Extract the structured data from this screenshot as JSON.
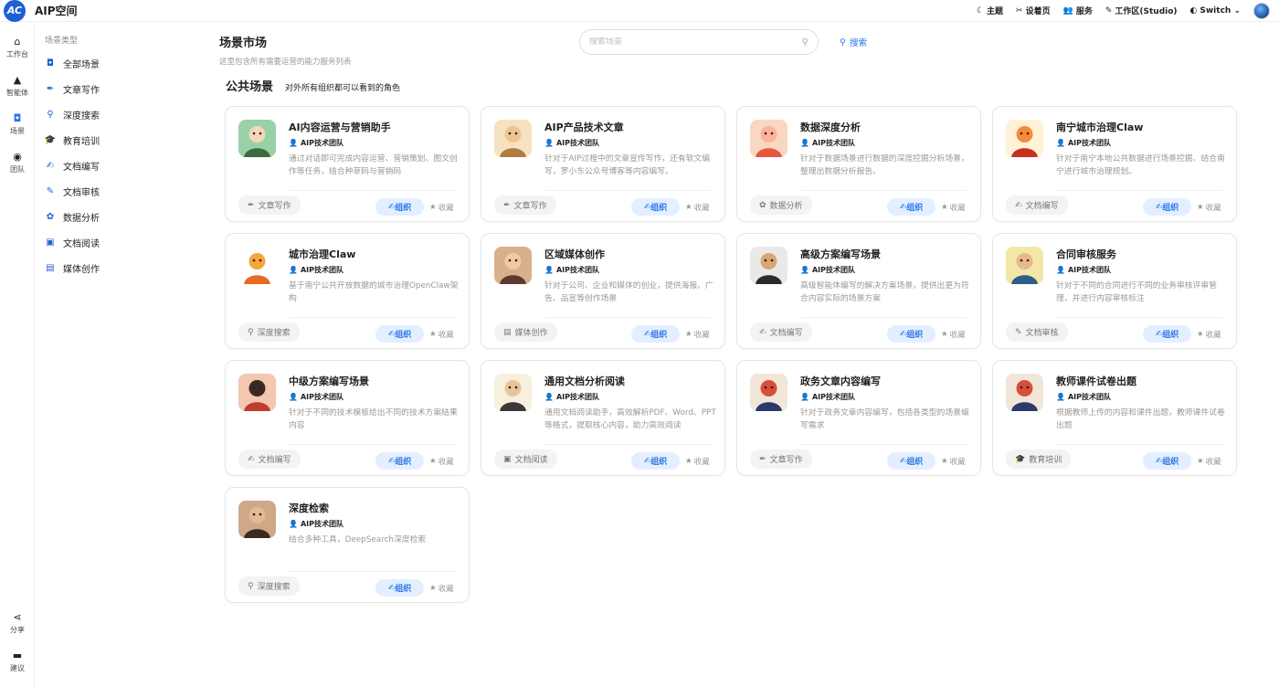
{
  "app": {
    "logo_text": "AC",
    "title": "AIP空间"
  },
  "topnav": [
    {
      "icon": "moon-icon",
      "glyph": "☾",
      "label": "主题"
    },
    {
      "icon": "tools-icon",
      "glyph": "✂",
      "label": "设着页"
    },
    {
      "icon": "users-icon",
      "glyph": "👥",
      "label": "服务"
    },
    {
      "icon": "pen-icon",
      "glyph": "✎",
      "label": "工作区(Studio)"
    },
    {
      "icon": "shield-icon",
      "glyph": "◐",
      "label": "Switch ⌄"
    }
  ],
  "rail": [
    {
      "icon": "home-icon",
      "glyph": "⌂",
      "label": "工作台"
    },
    {
      "icon": "agent-icon",
      "glyph": "▲",
      "label": "智能体"
    },
    {
      "icon": "scene-icon",
      "glyph": "◘",
      "label": "场景"
    },
    {
      "icon": "team-icon",
      "glyph": "◉",
      "label": "团队"
    },
    {
      "icon": "share-icon",
      "glyph": "⋖",
      "label": "分享"
    },
    {
      "icon": "chat-icon",
      "glyph": "▬",
      "label": "建议"
    }
  ],
  "sidebar": {
    "title": "场景类型",
    "items": [
      {
        "icon": "all-scenes-icon",
        "glyph": "◘",
        "label": "全部场景"
      },
      {
        "icon": "pen-icon",
        "glyph": "✒",
        "label": "文章写作"
      },
      {
        "icon": "search-icon",
        "glyph": "⚲",
        "label": "深度搜索"
      },
      {
        "icon": "graduation-cap-icon",
        "glyph": "🎓",
        "label": "教育培训"
      },
      {
        "icon": "doc-edit-icon",
        "glyph": "✍",
        "label": "文档编写"
      },
      {
        "icon": "doc-review-icon",
        "glyph": "✎",
        "label": "文档审核"
      },
      {
        "icon": "data-analysis-icon",
        "glyph": "✿",
        "label": "数据分析"
      },
      {
        "icon": "doc-read-icon",
        "glyph": "▣",
        "label": "文档阅读"
      },
      {
        "icon": "media-icon",
        "glyph": "▤",
        "label": "媒体创作"
      }
    ]
  },
  "header": {
    "title": "场景市场",
    "subtitle": "这里包含所有需要运营的能力服务列表",
    "search_placeholder": "搜索场景",
    "search_button": "搜索"
  },
  "section": {
    "title": "公共场景",
    "subtitle": "对外所有组织都可以看到的角色"
  },
  "card_common": {
    "team": "AIP技术团队",
    "org": "组织",
    "fav": "收藏"
  },
  "cards": [
    {
      "title": "AI内容运营与营销助手",
      "desc": "通过对话即可完成内容运营、营销策划、图文创作等任务，结合种草码与营销码",
      "tag": "文章写作",
      "tag_icon": "✒",
      "avatar": "a1"
    },
    {
      "title": "AIP产品技术文章",
      "desc": "针对于AIP过程中的文章宣传写作，还有软文编写，罗小东公众号博客等内容编写。",
      "tag": "文章写作",
      "tag_icon": "✒",
      "avatar": "a2"
    },
    {
      "title": "数据深度分析",
      "desc": "针对于数据场景进行数据的深度挖掘分析场景，整理出数据分析报告。",
      "tag": "数据分析",
      "tag_icon": "✿",
      "avatar": "a3"
    },
    {
      "title": "南宁城市治理Claw",
      "desc": "针对于南宁本地公共数据进行场景挖掘、结合南宁进行城市治理规划。",
      "tag": "文档编写",
      "tag_icon": "✍",
      "avatar": "a4"
    },
    {
      "title": "城市治理Claw",
      "desc": "基于南宁公共开放数据的城市治理OpenClaw架构",
      "tag": "深度搜索",
      "tag_icon": "⚲",
      "avatar": "a5"
    },
    {
      "title": "区域媒体创作",
      "desc": "针对于公司、企业和媒体的创业，提供海报、广告、品宣等创作场景",
      "tag": "媒体创作",
      "tag_icon": "▤",
      "avatar": "a6"
    },
    {
      "title": "高级方案编写场景",
      "desc": "高级智能体编写的解决方案场景，提供出更为符合内容实际的场景方案",
      "tag": "文档编写",
      "tag_icon": "✍",
      "avatar": "a7"
    },
    {
      "title": "合同审核服务",
      "desc": "针对于不同的合同进行不同的业务审核评审管理，并进行内容审核标注",
      "tag": "文档审核",
      "tag_icon": "✎",
      "avatar": "a8"
    },
    {
      "title": "中级方案编写场景",
      "desc": "针对于不同的技术模板给出不同的技术方案结果内容",
      "tag": "文档编写",
      "tag_icon": "✍",
      "avatar": "a9"
    },
    {
      "title": "通用文档分析阅读",
      "desc": "通用文档阅读助手，高效解析PDF、Word、PPT等格式，提取核心内容，助力高效阅读",
      "tag": "文档阅读",
      "tag_icon": "▣",
      "avatar": "a10"
    },
    {
      "title": "政务文章内容编写",
      "desc": "针对于政务文章内容编写，包括各类型的场景编写需求",
      "tag": "文章写作",
      "tag_icon": "✒",
      "avatar": "a11"
    },
    {
      "title": "教师课件试卷出题",
      "desc": "根据教师上传的内容和课件出题，教师课件试卷出题",
      "tag": "教育培训",
      "tag_icon": "🎓",
      "avatar": "a11"
    },
    {
      "title": "深度检索",
      "desc": "结合多种工具，DeepSearch深度检索",
      "tag": "深度搜索",
      "tag_icon": "⚲",
      "avatar": "a12"
    }
  ]
}
